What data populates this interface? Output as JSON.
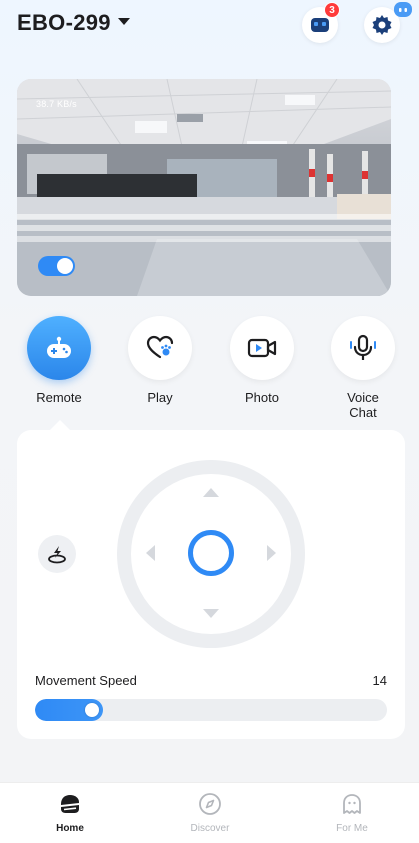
{
  "header": {
    "device_name": "EBO-299",
    "notification_count": "3"
  },
  "video": {
    "data_rate": "38.7 KB/s",
    "toggle_on": true
  },
  "features": [
    {
      "label": "Remote",
      "icon": "gamepad-icon",
      "active": true
    },
    {
      "label": "Play",
      "icon": "heart-paw-icon",
      "active": false
    },
    {
      "label": "Photo",
      "icon": "video-camera-icon",
      "active": false
    },
    {
      "label": "Voice\nChat",
      "icon": "microphone-icon",
      "active": false
    }
  ],
  "control": {
    "speed_label": "Movement Speed",
    "speed_value": "14",
    "speed_fraction": 0.14
  },
  "nav": {
    "home": "Home",
    "discover": "Discover",
    "forme": "For Me"
  },
  "colors": {
    "accent": "#2f8af5",
    "badge": "#ff3b3b"
  }
}
